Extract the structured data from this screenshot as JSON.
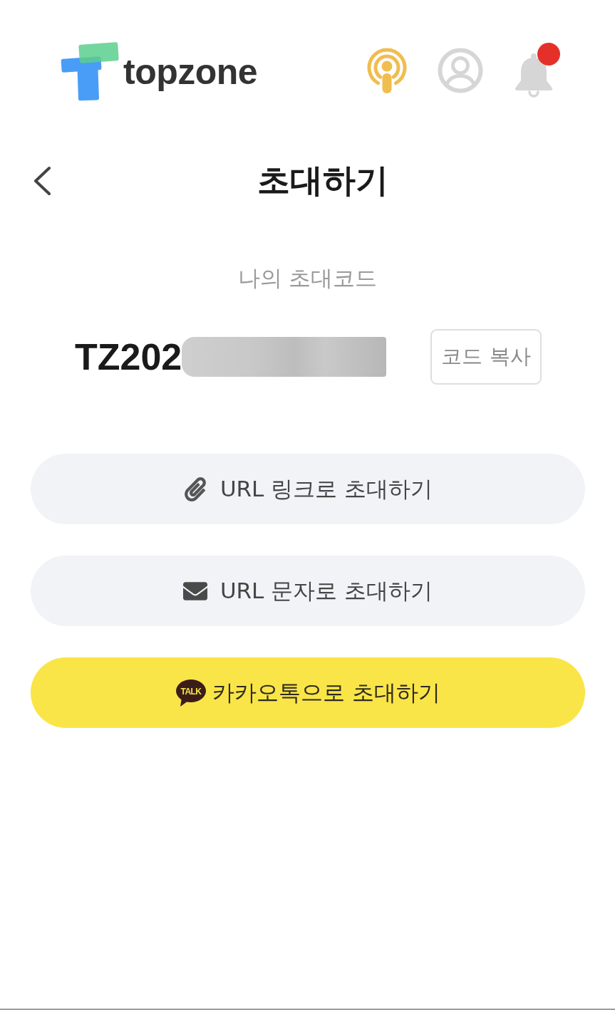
{
  "header": {
    "logo_text": "topzone",
    "notification_badge": true
  },
  "title_bar": {
    "title": "초대하기"
  },
  "invite_code": {
    "label": "나의 초대코드",
    "code": "TZ202",
    "redacted": true,
    "copy_button": "코드 복사"
  },
  "invite_options": [
    {
      "kind": "link",
      "label": "URL 링크로 초대하기"
    },
    {
      "kind": "sms",
      "label": "URL 문자로 초대하기"
    },
    {
      "kind": "kakao",
      "label": "카카오톡으로 초대하기",
      "icon_text": "TALK"
    }
  ]
}
